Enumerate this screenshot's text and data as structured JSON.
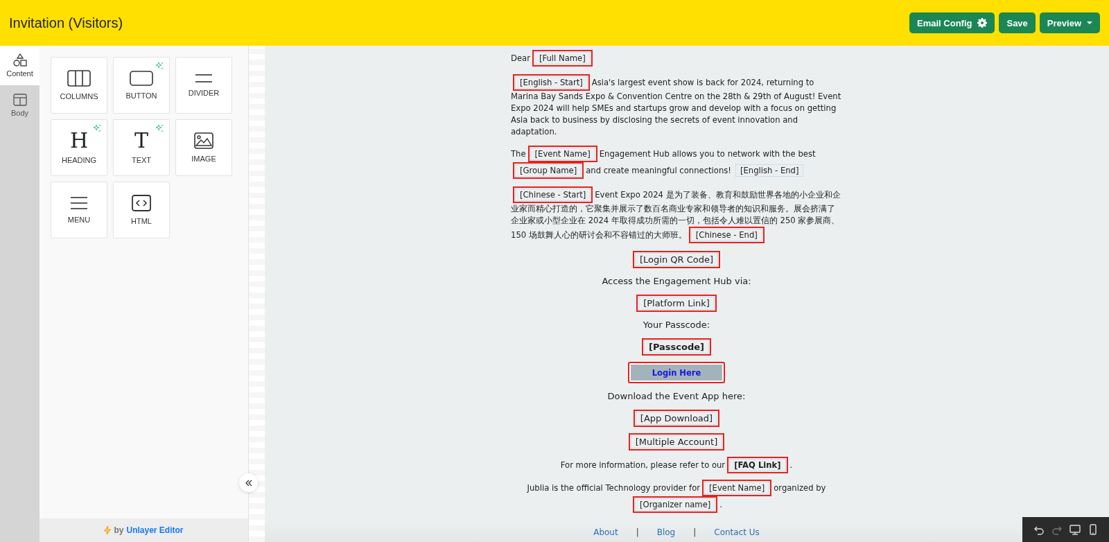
{
  "header": {
    "title": "Invitation (Visitors)",
    "buttons": [
      {
        "kind": "config",
        "label": "Email Config"
      },
      {
        "kind": "save",
        "label": "Save"
      },
      {
        "kind": "dropdown",
        "label": "Preview"
      }
    ]
  },
  "side_tabs": [
    {
      "kind": "content",
      "label": "Content",
      "selected": true
    },
    {
      "kind": "body",
      "label": "Body",
      "selected": false
    }
  ],
  "tools": [
    {
      "kind": "columns",
      "label": "COLUMNS",
      "sparkle": false
    },
    {
      "kind": "button",
      "label": "BUTTON",
      "sparkle": true
    },
    {
      "kind": "divider",
      "label": "DIVIDER",
      "sparkle": false
    },
    {
      "kind": "heading",
      "label": "HEADING",
      "sparkle": true,
      "glyph": "H"
    },
    {
      "kind": "text",
      "label": "TEXT",
      "sparkle": true,
      "glyph": "T"
    },
    {
      "kind": "image",
      "label": "IMAGE",
      "sparkle": false
    },
    {
      "kind": "menu",
      "label": "MENU",
      "sparkle": false
    },
    {
      "kind": "html",
      "label": "HTML",
      "sparkle": false
    }
  ],
  "branding": {
    "prefix": "by",
    "name": "Unlayer Editor"
  },
  "email": {
    "blocks": [
      {
        "kind": "paragraph",
        "segments": [
          {
            "kind": "text",
            "text": "Dear"
          },
          {
            "kind": "tag",
            "text": "[Full Name]",
            "highlighted": true,
            "bold": false
          }
        ]
      },
      {
        "kind": "paragraph",
        "segments": [
          {
            "kind": "tag",
            "text": "[English - Start]",
            "highlighted": true,
            "bold": false
          },
          {
            "kind": "text",
            "text": "Asia's largest event show is back for 2024, returning to Marina Bay Sands Expo & Convention Centre on the 28th & 29th of August! Event Expo 2024 will help SMEs and startups grow and develop with a focus on getting Asia back to business by disclosing the secrets of event innovation and adaptation."
          }
        ]
      },
      {
        "kind": "paragraph",
        "segments": [
          {
            "kind": "text",
            "text": "The"
          },
          {
            "kind": "tag",
            "text": "[Event Name]",
            "highlighted": true,
            "bold": false
          },
          {
            "kind": "text",
            "text": "Engagement Hub allows you to network with the best"
          },
          {
            "kind": "tag",
            "text": "[Group Name]",
            "highlighted": true,
            "bold": false
          },
          {
            "kind": "text",
            "text": "and create meaningful connections!"
          },
          {
            "kind": "tag",
            "text": "[English - End]",
            "highlighted": false,
            "bold": false
          }
        ]
      },
      {
        "kind": "paragraph",
        "segments": [
          {
            "kind": "tag",
            "text": "[Chinese - Start]",
            "highlighted": true,
            "bold": false
          },
          {
            "kind": "text",
            "text": "Event Expo 2024 是为了装备、教育和鼓励世界各地的小企业和企业家而精心打造的，它聚集并展示了数百名商业专家和领导者的知识和服务。展会挤满了企业家或小型企业在 2024 年取得成功所需的一切，包括令人难以置信的 250 家参展商、150 场鼓舞人心的研讨会和不容错过的大师班。"
          },
          {
            "kind": "tag",
            "text": "[Chinese - End]",
            "highlighted": true,
            "bold": false
          }
        ]
      },
      {
        "kind": "centered",
        "segments": [
          {
            "kind": "tag",
            "text": "[Login QR Code]",
            "highlighted": true,
            "bold": false
          }
        ]
      },
      {
        "kind": "centered",
        "segments": [
          {
            "kind": "text",
            "text": "Access the Engagement Hub via:"
          }
        ]
      },
      {
        "kind": "centered",
        "segments": [
          {
            "kind": "tag",
            "text": "[Platform Link]",
            "highlighted": true,
            "bold": false
          }
        ]
      },
      {
        "kind": "centered",
        "segments": [
          {
            "kind": "text",
            "text": "Your Passcode:"
          }
        ]
      },
      {
        "kind": "centered",
        "segments": [
          {
            "kind": "tag",
            "text": "[Passcode]",
            "highlighted": true,
            "bold": true
          }
        ]
      },
      {
        "kind": "button",
        "label": "Login Here",
        "highlighted": true
      },
      {
        "kind": "centered",
        "segments": [
          {
            "kind": "text",
            "text": "Download the Event App here:"
          }
        ]
      },
      {
        "kind": "centered",
        "segments": [
          {
            "kind": "tag",
            "text": "[App Download]",
            "highlighted": true,
            "bold": false
          }
        ]
      },
      {
        "kind": "centered",
        "segments": [
          {
            "kind": "tag",
            "text": "[Multiple Account]",
            "highlighted": true,
            "bold": false
          }
        ]
      },
      {
        "kind": "small",
        "segments": [
          {
            "kind": "text",
            "text": "For more information, please refer to our"
          },
          {
            "kind": "tag",
            "text": "[FAQ Link]",
            "highlighted": true,
            "bold": true
          },
          {
            "kind": "text",
            "text": "."
          }
        ]
      },
      {
        "kind": "small",
        "segments": [
          {
            "kind": "text",
            "text": "Jublia is the official Technology provider for"
          },
          {
            "kind": "tag",
            "text": "[Event Name]",
            "highlighted": true,
            "bold": false
          },
          {
            "kind": "text",
            "text": "organized by"
          },
          {
            "kind": "tag",
            "text": "[Organizer name]",
            "highlighted": true,
            "bold": false
          },
          {
            "kind": "text",
            "text": "."
          }
        ]
      }
    ],
    "footer": [
      {
        "kind": "link",
        "text": "About"
      },
      {
        "kind": "separator",
        "text": "|"
      },
      {
        "kind": "link",
        "text": "Blog"
      },
      {
        "kind": "separator",
        "text": "|"
      },
      {
        "kind": "link",
        "text": "Contact Us"
      }
    ]
  },
  "toolbar": [
    {
      "kind": "undo",
      "disabled": false
    },
    {
      "kind": "redo",
      "disabled": true
    },
    {
      "kind": "desktop",
      "disabled": false
    },
    {
      "kind": "mobile",
      "disabled": false
    }
  ]
}
